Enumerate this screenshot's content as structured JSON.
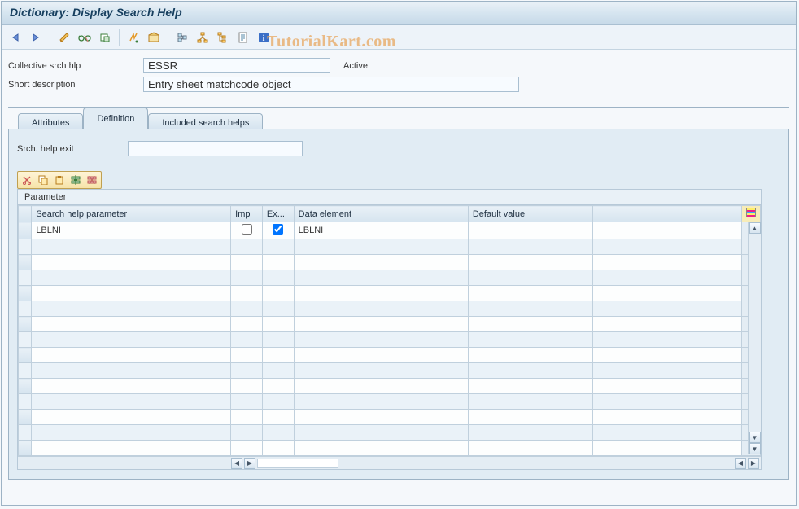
{
  "title": "Dictionary: Display Search Help",
  "watermark": "TutorialKart.com",
  "fields": {
    "collective_label": "Collective srch hlp",
    "collective_value": "ESSR",
    "status": "Active",
    "shortdesc_label": "Short description",
    "shortdesc_value": "Entry sheet matchcode object",
    "srch_exit_label": "Srch. help exit",
    "srch_exit_value": ""
  },
  "tabs": {
    "attributes": "Attributes",
    "definition": "Definition",
    "included": "Included search helps"
  },
  "grid": {
    "group_label": "Parameter",
    "cols": {
      "param": "Search help parameter",
      "imp": "Imp",
      "exp": "Ex...",
      "de": "Data element",
      "defval": "Default value"
    },
    "rows": [
      {
        "param": "LBLNI",
        "imp": false,
        "exp": true,
        "de": "LBLNI",
        "defval": ""
      }
    ],
    "blank_rows": 14
  },
  "icons": {
    "back": "back-arrow",
    "fwd": "forward-arrow",
    "pencil": "pencil",
    "glasses": "glasses",
    "display": "toggle-display",
    "activate": "activate",
    "check": "check",
    "where": "where-used",
    "hier": "hierarchy",
    "other": "other-object",
    "doc": "documentation",
    "info": "info",
    "cut": "cut",
    "copy": "copy",
    "paste": "paste",
    "insrow": "insert-row",
    "delrow": "delete-row"
  }
}
